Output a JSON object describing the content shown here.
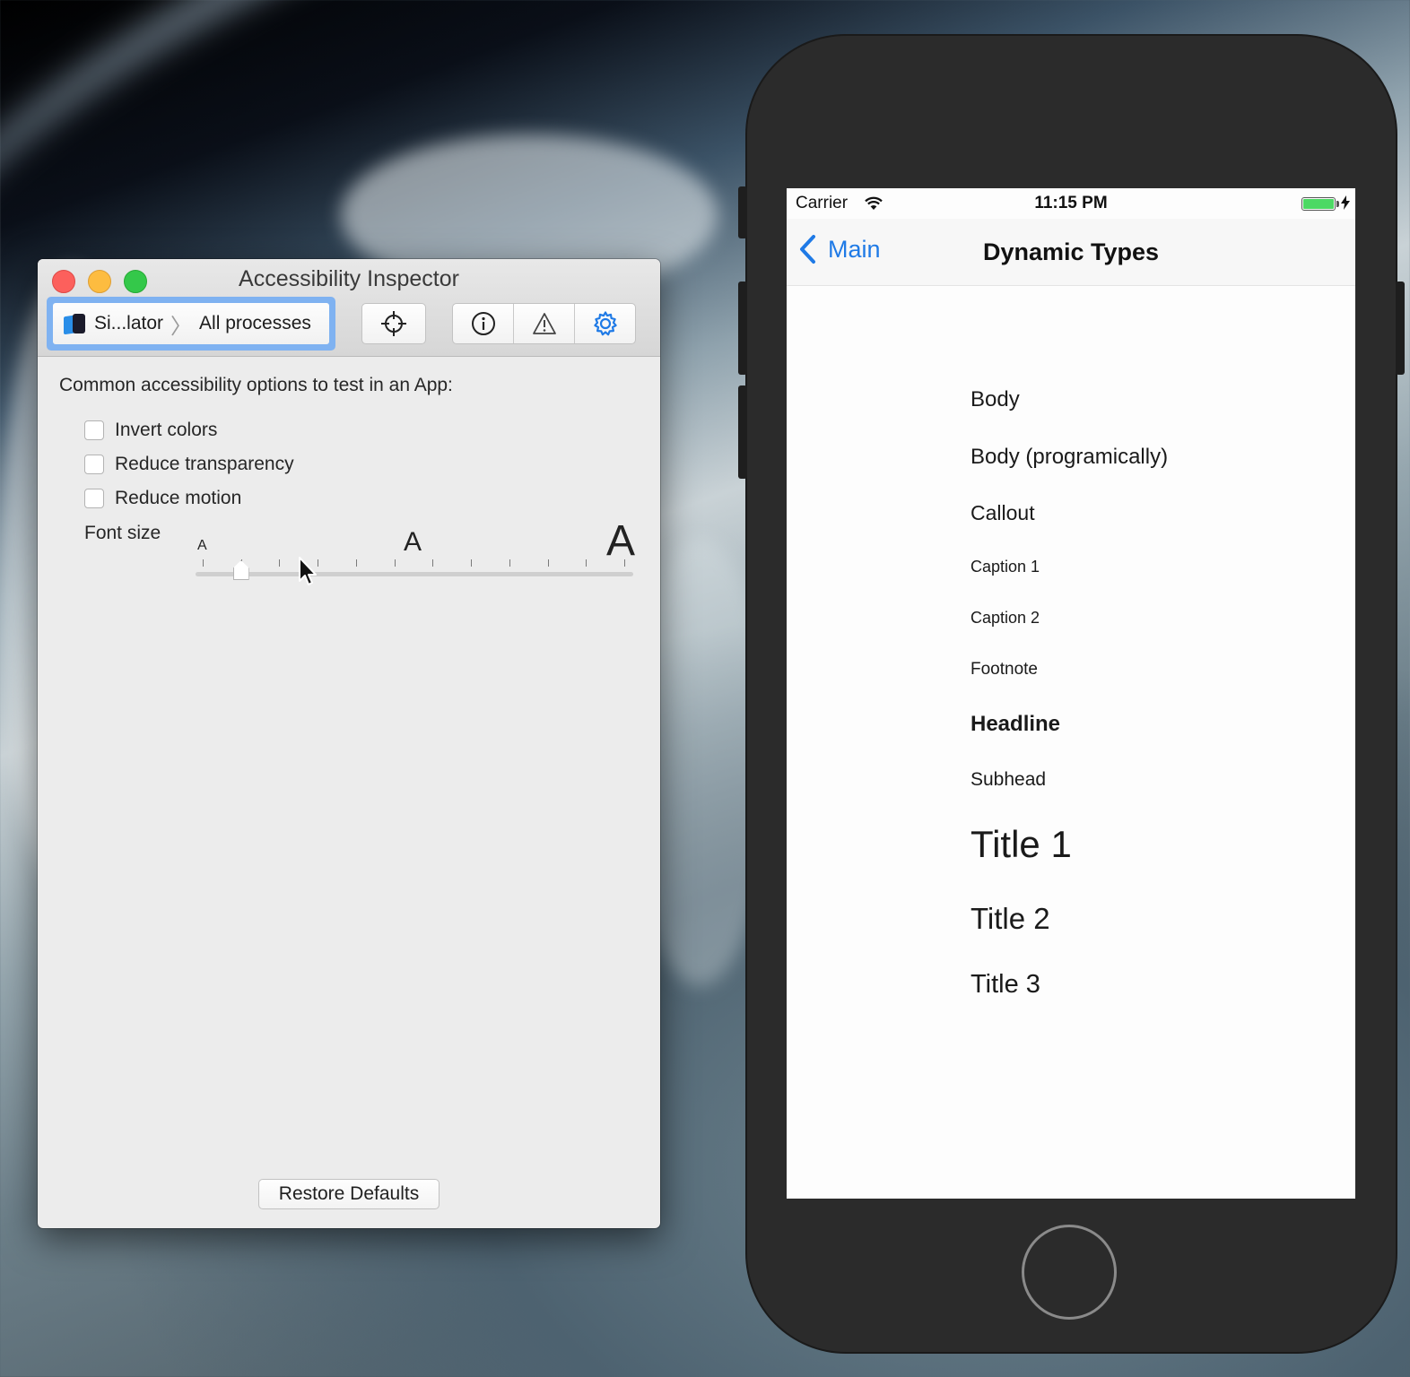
{
  "inspector": {
    "title": "Accessibility Inspector",
    "target": {
      "app": "Si...lator",
      "separator": "〉",
      "process": "All processes"
    },
    "toolbar_icons": [
      "crosshair-icon",
      "info-icon",
      "warning-icon",
      "gear-icon"
    ],
    "intro": "Common accessibility options to test in an App:",
    "options": [
      {
        "label": "Invert colors",
        "checked": false
      },
      {
        "label": "Reduce transparency",
        "checked": false
      },
      {
        "label": "Reduce motion",
        "checked": false
      }
    ],
    "font_size": {
      "label": "Font size",
      "small_glyph": "A",
      "medium_glyph": "A",
      "large_glyph": "A",
      "ticks": 12,
      "selected_step": 1
    },
    "restore_label": "Restore Defaults",
    "accent": "#1f7ae6"
  },
  "phone": {
    "status": {
      "carrier": "Carrier",
      "time": "11:15 PM"
    },
    "nav": {
      "back": "Main",
      "title": "Dynamic Types"
    },
    "types": [
      "Body",
      "Body (programically)",
      "Callout",
      "Caption 1",
      "Caption 2",
      "Footnote",
      "Headline",
      "Subhead",
      "Title 1",
      "Title 2",
      "Title 3"
    ],
    "battery_color": "#4cd964"
  }
}
